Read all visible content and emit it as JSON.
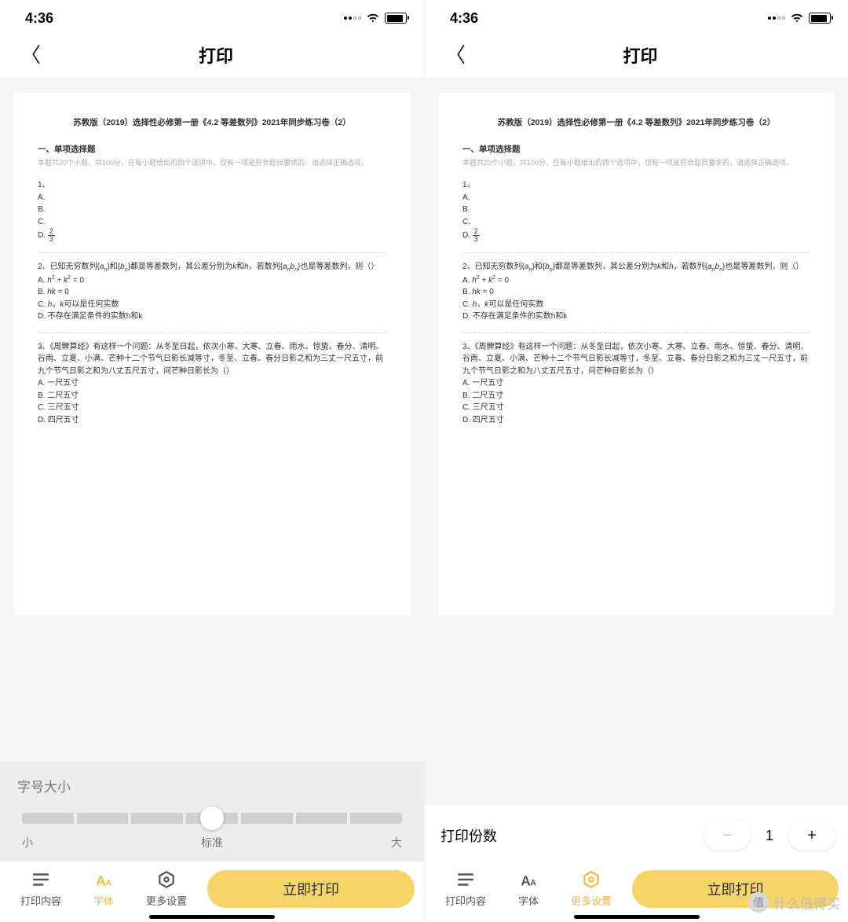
{
  "status_bar": {
    "time": "4:36"
  },
  "nav": {
    "title": "打印"
  },
  "doc": {
    "title": "苏教版（2019）选择性必修第一册《4.2 等差数列》2021年同步练习卷（2）",
    "section_title": "一、单项选择题",
    "section_sub": "本题共20个小题，共100分。在每小题给出的四个选项中，仅有一项是符合题目要求的，请选择正确选项。",
    "q1": {
      "num": "1、",
      "a": "A.",
      "b": "B.",
      "c": "C.",
      "d": "D.",
      "frac_n": "2",
      "frac_d": "3"
    },
    "q2": {
      "stem_pre": "2、已知无穷数列{",
      "an": "a",
      "ansub": "n",
      "stem_mid1": "}和{",
      "bn": "b",
      "bnsub": "n",
      "stem_mid2": "}都是等差数列，其公差分别为",
      "k": "k",
      "and": "和",
      "h": "h",
      "stem_mid3": "，若数列{",
      "stem_mid4": "}也是等差数列，则（）",
      "a": "A.",
      "a_math": "h² + k² = 0",
      "b": "B.",
      "b_math": "hk = 0",
      "c": "C.",
      "c_text": "h，k可以是任何实数",
      "d": "D.",
      "d_text": "不存在满足条件的实数h和k"
    },
    "q3": {
      "stem": "3、《周髀算经》有这样一个问题：从冬至日起，依次小寒、大寒、立春、雨水、惊蛰、春分、清明、谷雨、立夏、小满、芒种十二个节气日影长减等寸，冬至、立春、春分日影之和为三丈一尺五寸，前九个节气日影之和为八丈五尺五寸，问芒种日影长为（）",
      "a": "A. 一尺五寸",
      "b": "B. 二尺五寸",
      "c": "C. 三尺五寸",
      "d": "D. 四尺五寸"
    }
  },
  "font_panel": {
    "title": "字号大小",
    "small": "小",
    "standard": "标准",
    "large": "大"
  },
  "copies_panel": {
    "label": "打印份数",
    "value": "1"
  },
  "tabs": {
    "content": "打印内容",
    "font": "字体",
    "more": "更多设置"
  },
  "print_button": "立即打印",
  "watermark": "什么值得买",
  "watermark_badge": "值"
}
